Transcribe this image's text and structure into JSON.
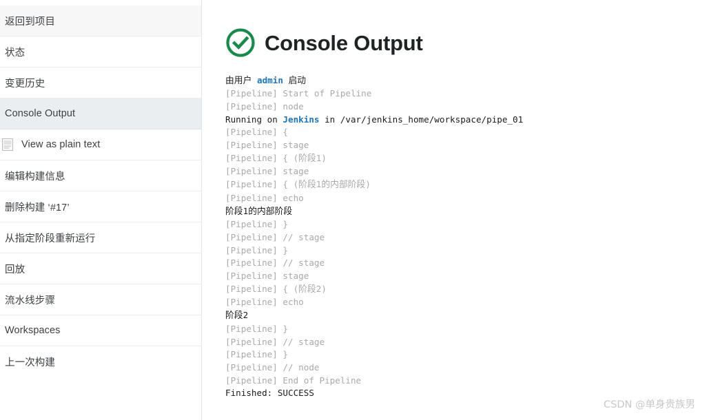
{
  "sidebar": {
    "items": [
      {
        "label": "返回到项目",
        "style": "shaded",
        "icon": null
      },
      {
        "label": "状态",
        "style": "plain",
        "icon": null
      },
      {
        "label": "变更历史",
        "style": "plain",
        "icon": null
      },
      {
        "label": "Console Output",
        "style": "selected",
        "icon": null
      },
      {
        "label": "View as plain text",
        "style": "plain",
        "icon": "document-icon"
      },
      {
        "label": "编辑构建信息",
        "style": "plain",
        "icon": null
      },
      {
        "label": "删除构建 ‘#17’",
        "style": "plain",
        "icon": null
      },
      {
        "label": "从指定阶段重新运行",
        "style": "plain",
        "icon": null
      },
      {
        "label": "回放",
        "style": "plain",
        "icon": null
      },
      {
        "label": "流水线步骤",
        "style": "plain",
        "icon": null
      },
      {
        "label": "Workspaces",
        "style": "plain",
        "icon": null
      },
      {
        "label": "上一次构建",
        "style": "plain",
        "icon": null
      }
    ]
  },
  "header": {
    "title": "Console Output",
    "status_icon": "success-check-circle-icon",
    "status_color": "#1a8a4a"
  },
  "console": {
    "started_by": {
      "prefix": "由用户 ",
      "user": "admin",
      "suffix": " 启动"
    },
    "running_on": {
      "prefix": "Running on ",
      "node": "Jenkins",
      "suffix": " in /var/jenkins_home/workspace/pipe_01"
    },
    "pipeline_tag": "[Pipeline]",
    "lines": [
      {
        "kind": "pipeline",
        "text": " Start of Pipeline"
      },
      {
        "kind": "pipeline",
        "text": " node"
      },
      {
        "kind": "running"
      },
      {
        "kind": "pipeline",
        "text": " {"
      },
      {
        "kind": "pipeline",
        "text": " stage"
      },
      {
        "kind": "pipeline",
        "text": " { (阶段1)"
      },
      {
        "kind": "pipeline",
        "text": " stage"
      },
      {
        "kind": "pipeline",
        "text": " { (阶段1的内部阶段)"
      },
      {
        "kind": "pipeline",
        "text": " echo"
      },
      {
        "kind": "echo",
        "text": "阶段1的内部阶段"
      },
      {
        "kind": "pipeline",
        "text": " }"
      },
      {
        "kind": "pipeline",
        "text": " // stage"
      },
      {
        "kind": "pipeline",
        "text": " }"
      },
      {
        "kind": "pipeline",
        "text": " // stage"
      },
      {
        "kind": "pipeline",
        "text": " stage"
      },
      {
        "kind": "pipeline",
        "text": " { (阶段2)"
      },
      {
        "kind": "pipeline",
        "text": " echo"
      },
      {
        "kind": "echo",
        "text": "阶段2"
      },
      {
        "kind": "pipeline",
        "text": " }"
      },
      {
        "kind": "pipeline",
        "text": " // stage"
      },
      {
        "kind": "pipeline",
        "text": " }"
      },
      {
        "kind": "pipeline",
        "text": " // node"
      },
      {
        "kind": "pipeline",
        "text": " End of Pipeline"
      },
      {
        "kind": "finished",
        "text": "Finished: SUCCESS"
      }
    ]
  },
  "watermark": {
    "text": "CSDN @单身贵族男"
  }
}
